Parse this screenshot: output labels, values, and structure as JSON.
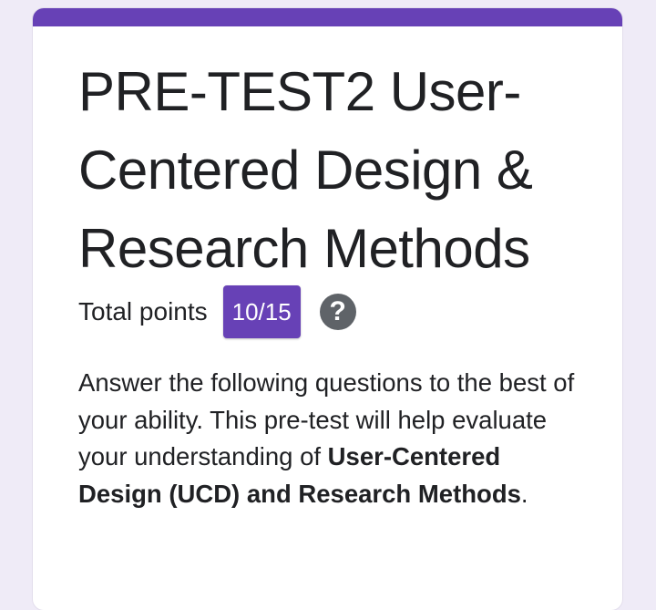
{
  "form": {
    "title": "PRE-TEST2 User-Centered Design & Research Methods",
    "total_points_label": "Total points",
    "score": "10/15",
    "help_icon": "question-mark-icon",
    "description": {
      "lead": " Answer the following questions to the best of your ability. This pre-test will help evaluate your understanding of ",
      "bold_topic": "User-Centered Design (UCD) and Research Methods",
      "end": "."
    }
  },
  "colors": {
    "accent": "#6741b6",
    "background": "#efebf7",
    "card": "#ffffff",
    "text": "#202124",
    "help_icon": "#5f6368"
  }
}
